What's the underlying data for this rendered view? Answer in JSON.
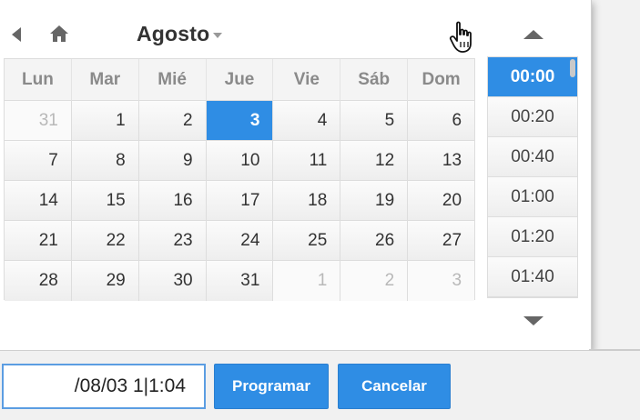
{
  "picker": {
    "month": "Agosto",
    "weekdays": [
      "Lun",
      "Mar",
      "Mié",
      "Jue",
      "Vie",
      "Sáb",
      "Dom"
    ],
    "weeks": [
      [
        {
          "day": "31",
          "other": true
        },
        {
          "day": "1",
          "other": false
        },
        {
          "day": "2",
          "other": false
        },
        {
          "day": "3",
          "other": false,
          "selected": true
        },
        {
          "day": "4",
          "other": false
        },
        {
          "day": "5",
          "other": false
        },
        {
          "day": "6",
          "other": false
        }
      ],
      [
        {
          "day": "7",
          "other": false
        },
        {
          "day": "8",
          "other": false
        },
        {
          "day": "9",
          "other": false
        },
        {
          "day": "10",
          "other": false
        },
        {
          "day": "11",
          "other": false
        },
        {
          "day": "12",
          "other": false
        },
        {
          "day": "13",
          "other": false
        }
      ],
      [
        {
          "day": "14",
          "other": false
        },
        {
          "day": "15",
          "other": false
        },
        {
          "day": "16",
          "other": false
        },
        {
          "day": "17",
          "other": false
        },
        {
          "day": "18",
          "other": false
        },
        {
          "day": "19",
          "other": false
        },
        {
          "day": "20",
          "other": false
        }
      ],
      [
        {
          "day": "21",
          "other": false
        },
        {
          "day": "22",
          "other": false
        },
        {
          "day": "23",
          "other": false
        },
        {
          "day": "24",
          "other": false
        },
        {
          "day": "25",
          "other": false
        },
        {
          "day": "26",
          "other": false
        },
        {
          "day": "27",
          "other": false
        }
      ],
      [
        {
          "day": "28",
          "other": false
        },
        {
          "day": "29",
          "other": false
        },
        {
          "day": "30",
          "other": false
        },
        {
          "day": "31",
          "other": false
        },
        {
          "day": "1",
          "other": true
        },
        {
          "day": "2",
          "other": true
        },
        {
          "day": "3",
          "other": true
        }
      ]
    ],
    "times": [
      {
        "label": "00:00",
        "selected": true
      },
      {
        "label": "00:20",
        "selected": false
      },
      {
        "label": "00:40",
        "selected": false
      },
      {
        "label": "01:00",
        "selected": false
      },
      {
        "label": "01:20",
        "selected": false
      },
      {
        "label": "01:40",
        "selected": false
      }
    ]
  },
  "form": {
    "datetime_value": "/08/03 1|1:04",
    "schedule_label": "Programar",
    "cancel_label": "Cancelar"
  },
  "icons": {
    "prev": "triangle-left-icon",
    "home": "home-icon",
    "month_dropdown": "caret-down-icon",
    "cursor": "hand-pointer-icon",
    "time_up": "triangle-up-icon",
    "time_down": "triangle-down-icon"
  },
  "colors": {
    "accent": "#2f8de4",
    "muted_day": "#b8b8b8",
    "weekday_header": "#8a8a8a"
  }
}
